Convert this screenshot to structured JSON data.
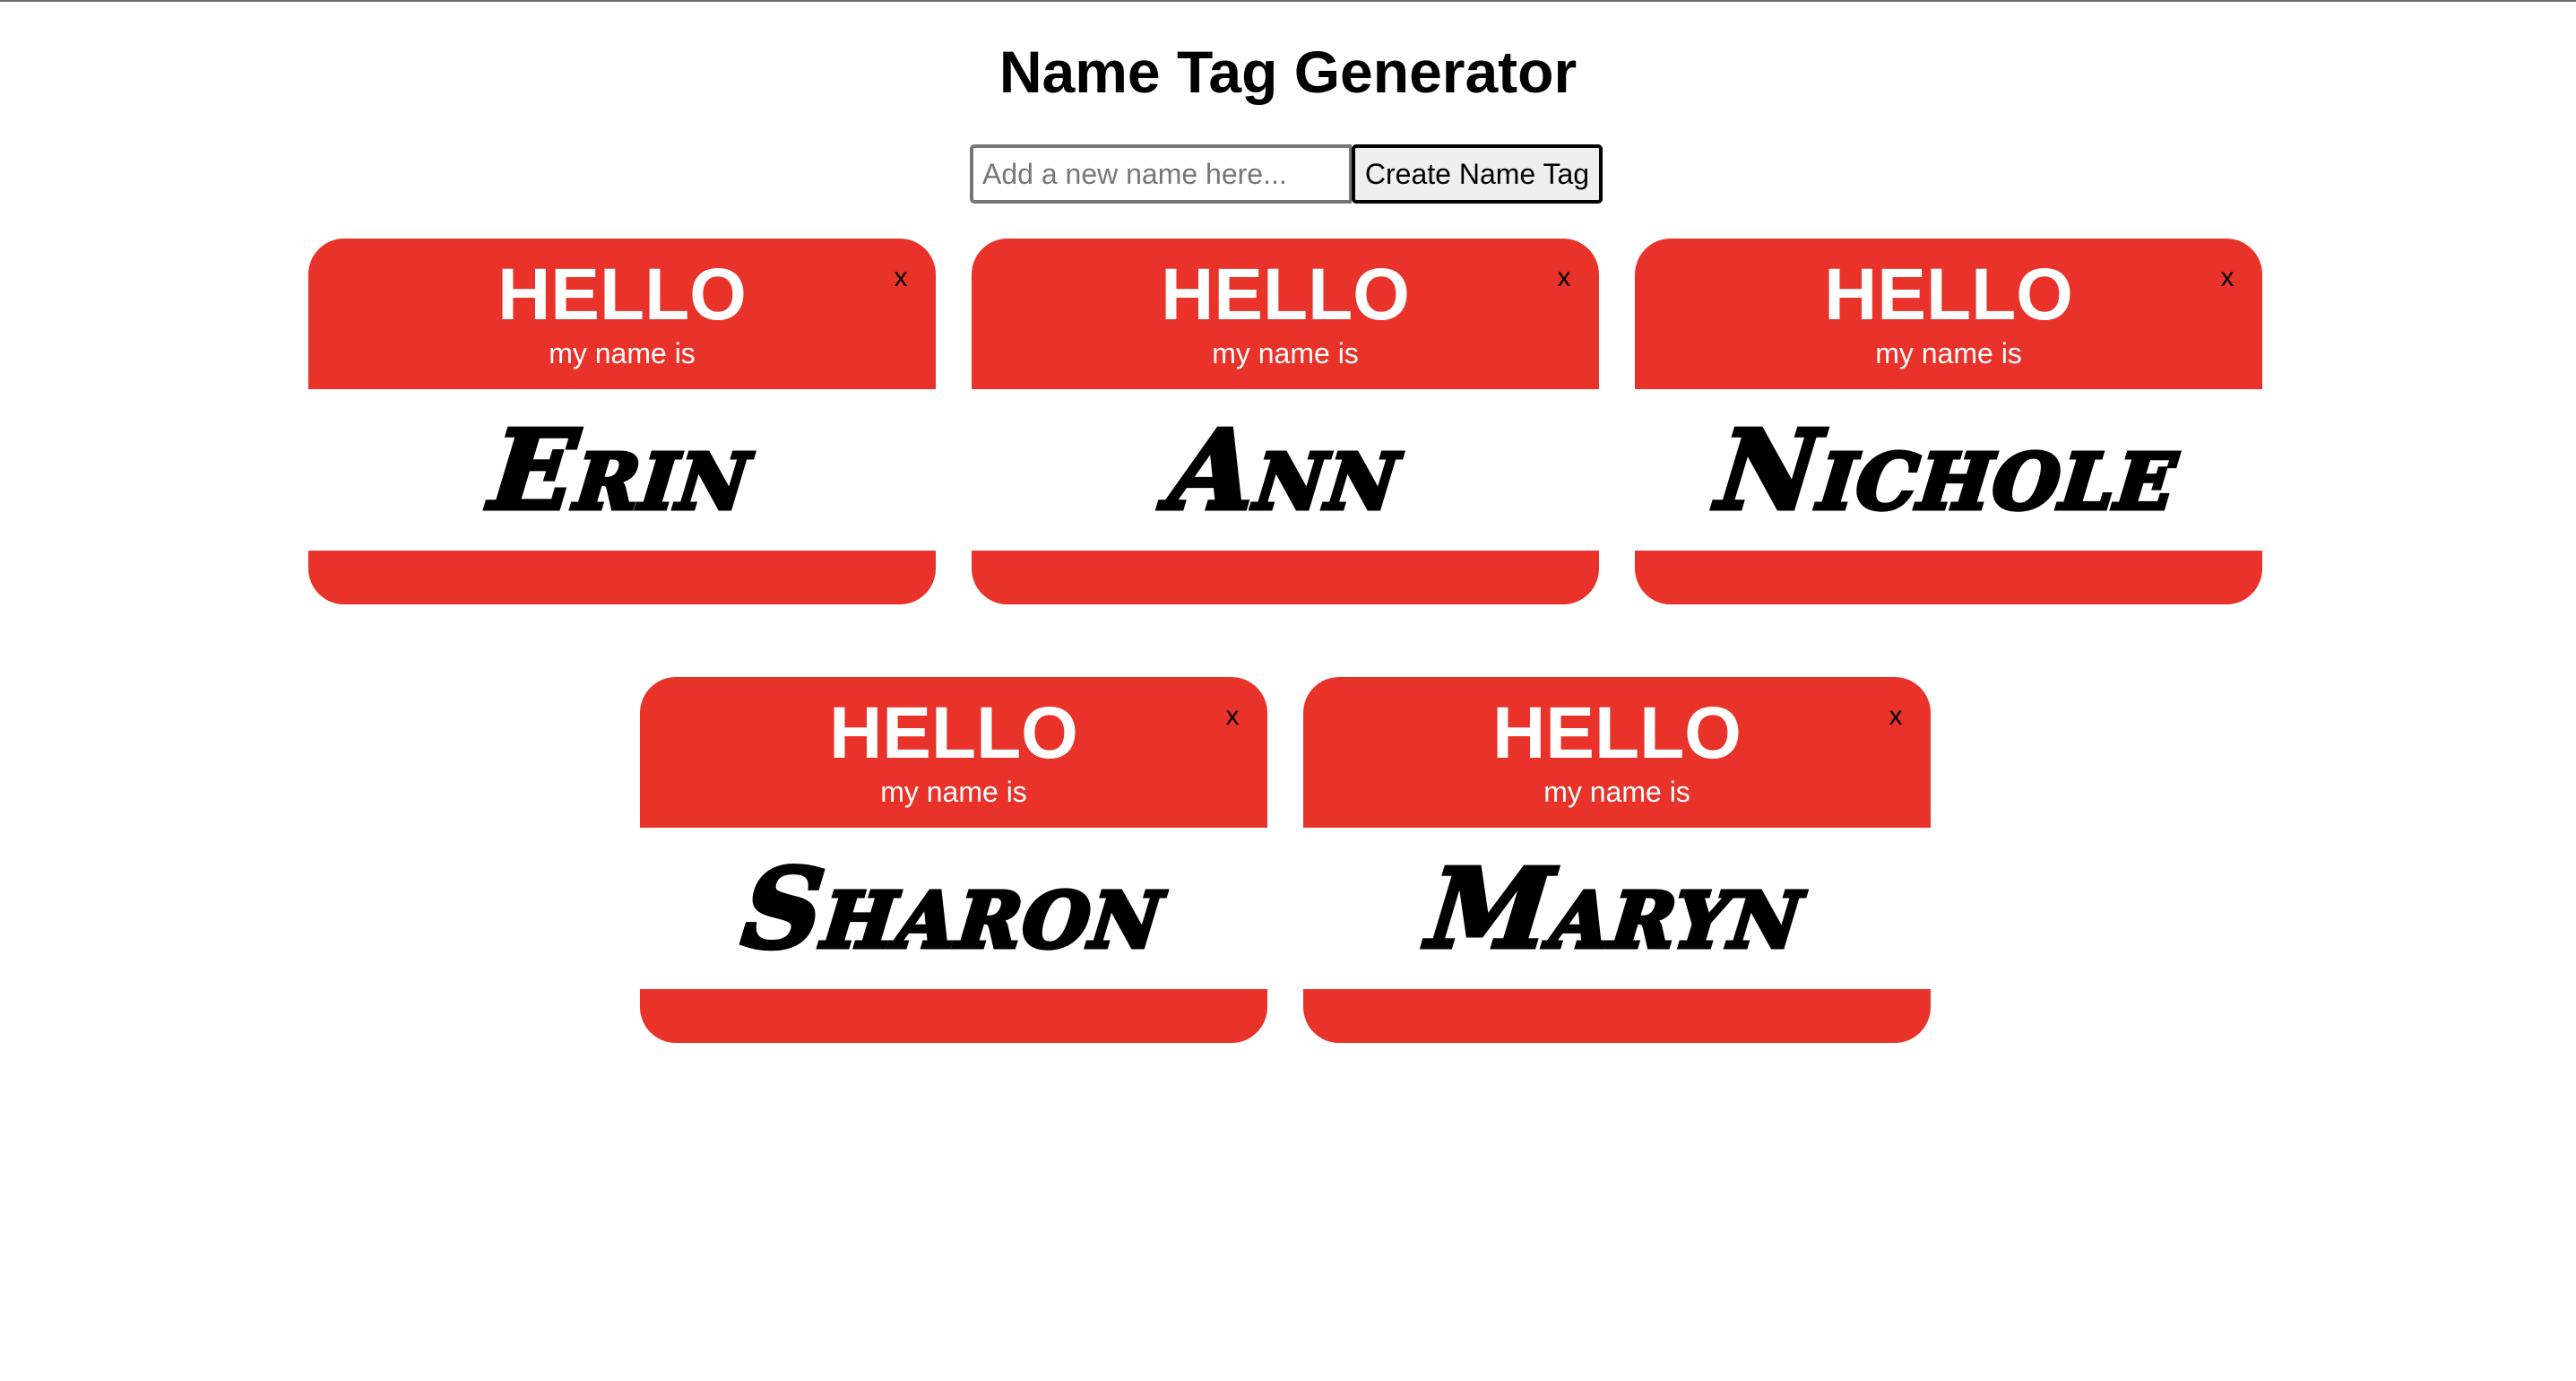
{
  "header": {
    "title": "Name Tag Generator"
  },
  "form": {
    "input_value": "",
    "input_placeholder": "Add a new name here...",
    "button_label": "Create Name Tag"
  },
  "tag_template": {
    "hello": "HELLO",
    "subtitle": "my name is",
    "close": "x"
  },
  "tags": [
    {
      "name": "Erin"
    },
    {
      "name": "Ann"
    },
    {
      "name": "Nichole"
    },
    {
      "name": "Sharon"
    },
    {
      "name": "Maryn"
    }
  ],
  "colors": {
    "tag_red": "#e8322a",
    "tag_white": "#ffffff",
    "button_bg": "#efefef"
  }
}
